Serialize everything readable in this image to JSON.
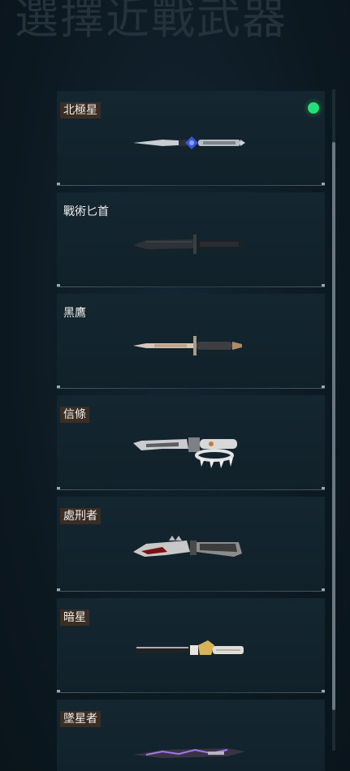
{
  "header": {
    "title": "選擇近戰武器"
  },
  "weapons": [
    {
      "name": "北極星",
      "tagged": true,
      "equipped": true,
      "icon": "dagger-blue-gem-icon"
    },
    {
      "name": "戰術匕首",
      "tagged": false,
      "equipped": false,
      "icon": "tactical-knife-icon"
    },
    {
      "name": "黑鷹",
      "tagged": false,
      "equipped": false,
      "icon": "stiletto-knife-icon"
    },
    {
      "name": "信條",
      "tagged": true,
      "equipped": false,
      "icon": "spiked-knuckle-knife-icon"
    },
    {
      "name": "處刑者",
      "tagged": true,
      "equipped": false,
      "icon": "serrated-bloody-knife-icon"
    },
    {
      "name": "暗星",
      "tagged": true,
      "equipped": false,
      "icon": "gold-tanto-knife-icon"
    },
    {
      "name": "墜星者",
      "tagged": true,
      "equipped": false,
      "icon": "purple-blade-knife-icon"
    }
  ],
  "colors": {
    "equipped_indicator": "#22e07a",
    "tag_background": "#3a2d24"
  }
}
